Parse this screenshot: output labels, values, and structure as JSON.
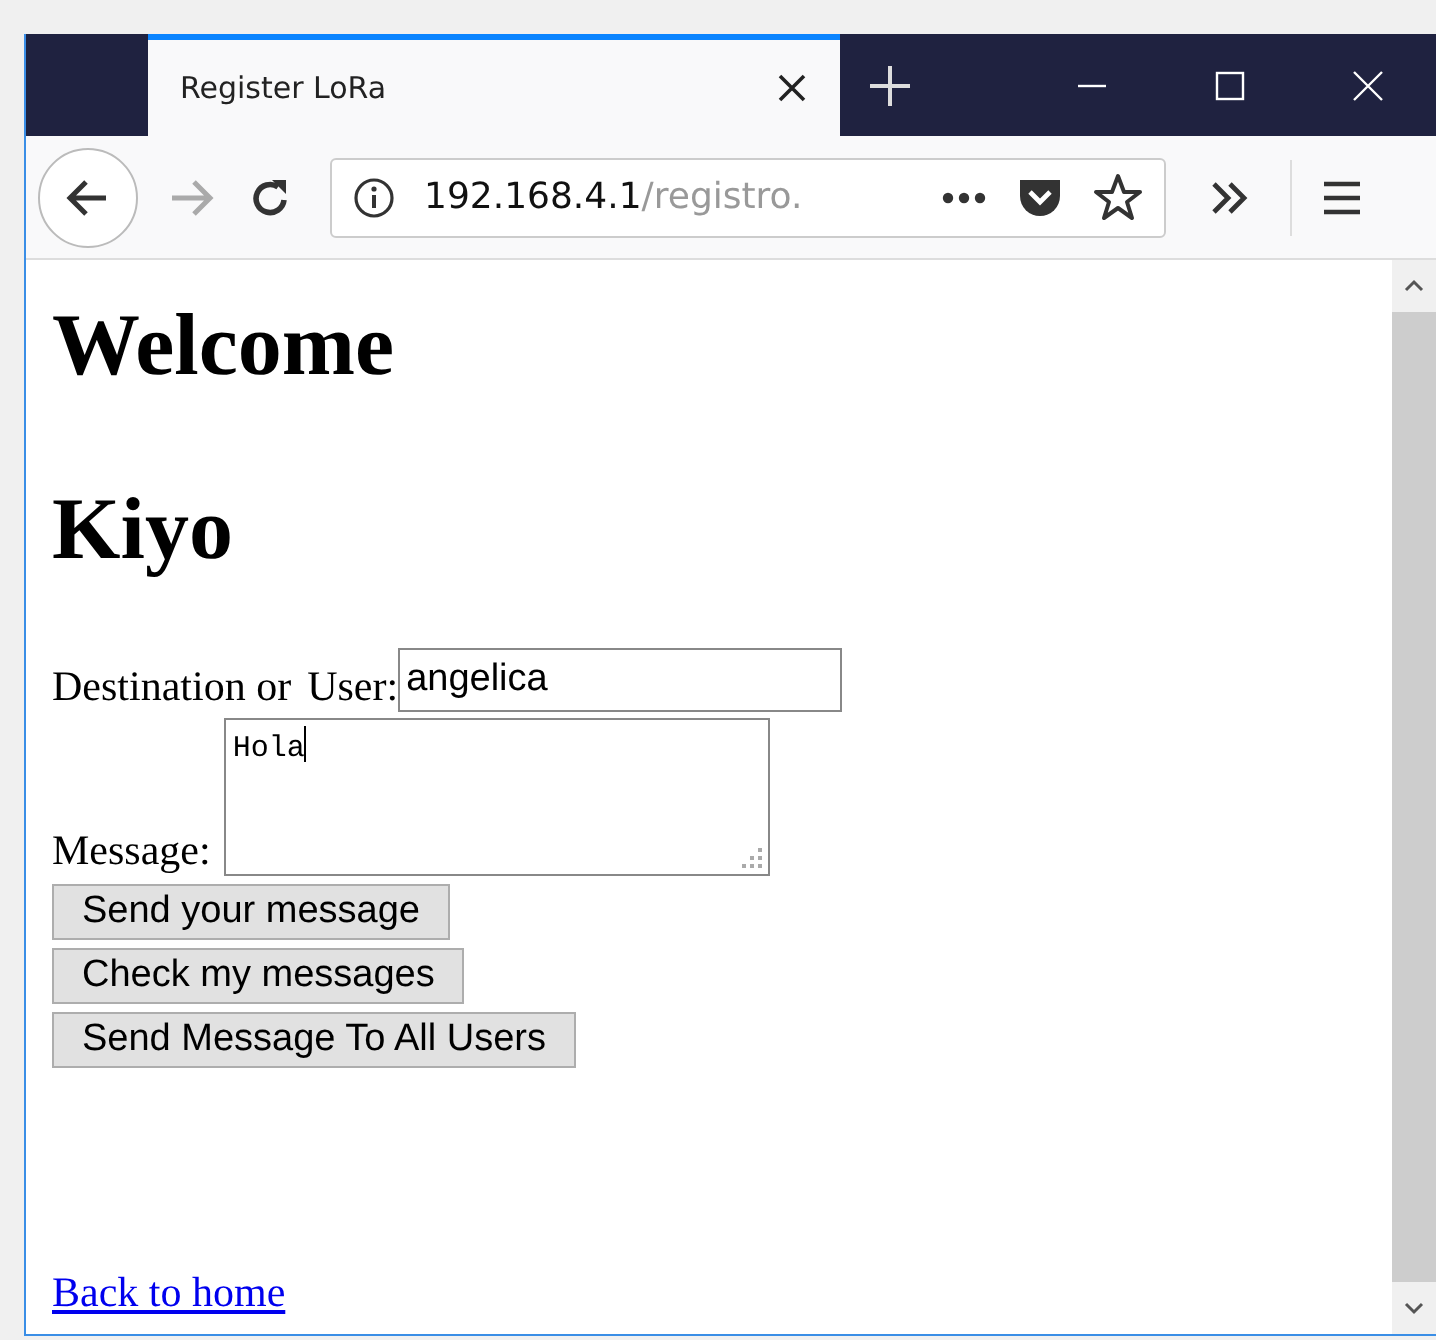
{
  "tab": {
    "title": "Register LoRa",
    "selected": true
  },
  "address_bar": {
    "host": "192.168.4.1",
    "path": "/registro."
  },
  "page": {
    "headings": [
      "Welcome",
      "Kiyo"
    ],
    "destination": {
      "label_1": "Destination or",
      "label_2": "User:",
      "value": "angelica"
    },
    "message": {
      "label": "Message:",
      "value": "Hola"
    },
    "buttons": [
      "Send your message",
      "Check my messages",
      "Send Message To All Users"
    ],
    "link": "Back to home"
  }
}
